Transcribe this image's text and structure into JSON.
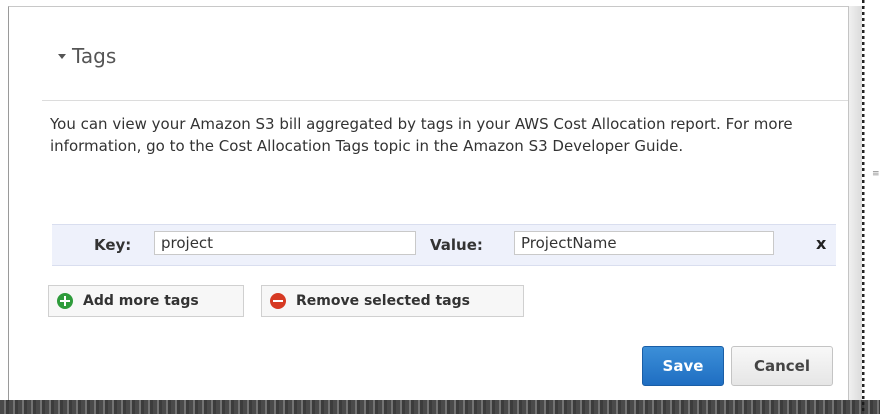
{
  "section": {
    "title": "Tags",
    "description": "You can view your Amazon S3 bill aggregated by tags in your AWS Cost Allocation report. For more information, go to the Cost Allocation Tags topic in the Amazon S3 Developer Guide."
  },
  "tag_row": {
    "key_label": "Key:",
    "key_value": "project",
    "value_label": "Value:",
    "value_value": "ProjectName",
    "remove_glyph": "x"
  },
  "actions": {
    "add_label": "Add more tags",
    "add_icon": "plus-circle-icon",
    "remove_label": "Remove selected tags",
    "remove_icon": "minus-circle-icon"
  },
  "footer": {
    "save_label": "Save",
    "cancel_label": "Cancel"
  },
  "colors": {
    "save_button": "#1f6ec2",
    "add_icon": "#2e9b3b",
    "remove_icon": "#d63a23",
    "row_background": "#eef1fb"
  }
}
